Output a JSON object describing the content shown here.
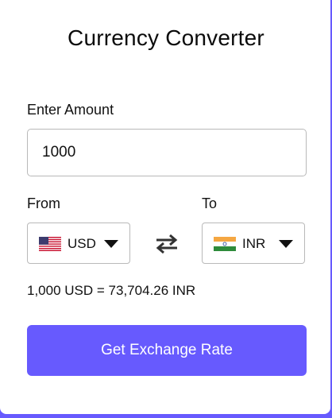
{
  "app": {
    "title": "Currency Converter"
  },
  "amount": {
    "label": "Enter Amount",
    "value": "1000"
  },
  "from": {
    "label": "From",
    "currency": "USD",
    "flag": "us-flag-icon"
  },
  "to": {
    "label": "To",
    "currency": "INR",
    "flag": "india-flag-icon"
  },
  "swap": {
    "icon": "swap-arrows-icon"
  },
  "result": {
    "text": "1,000 USD = 73,704.26 INR"
  },
  "action": {
    "label": "Get Exchange Rate"
  },
  "colors": {
    "accent": "#675afe",
    "background": "#ffffff",
    "border": "#b9b9b9"
  }
}
